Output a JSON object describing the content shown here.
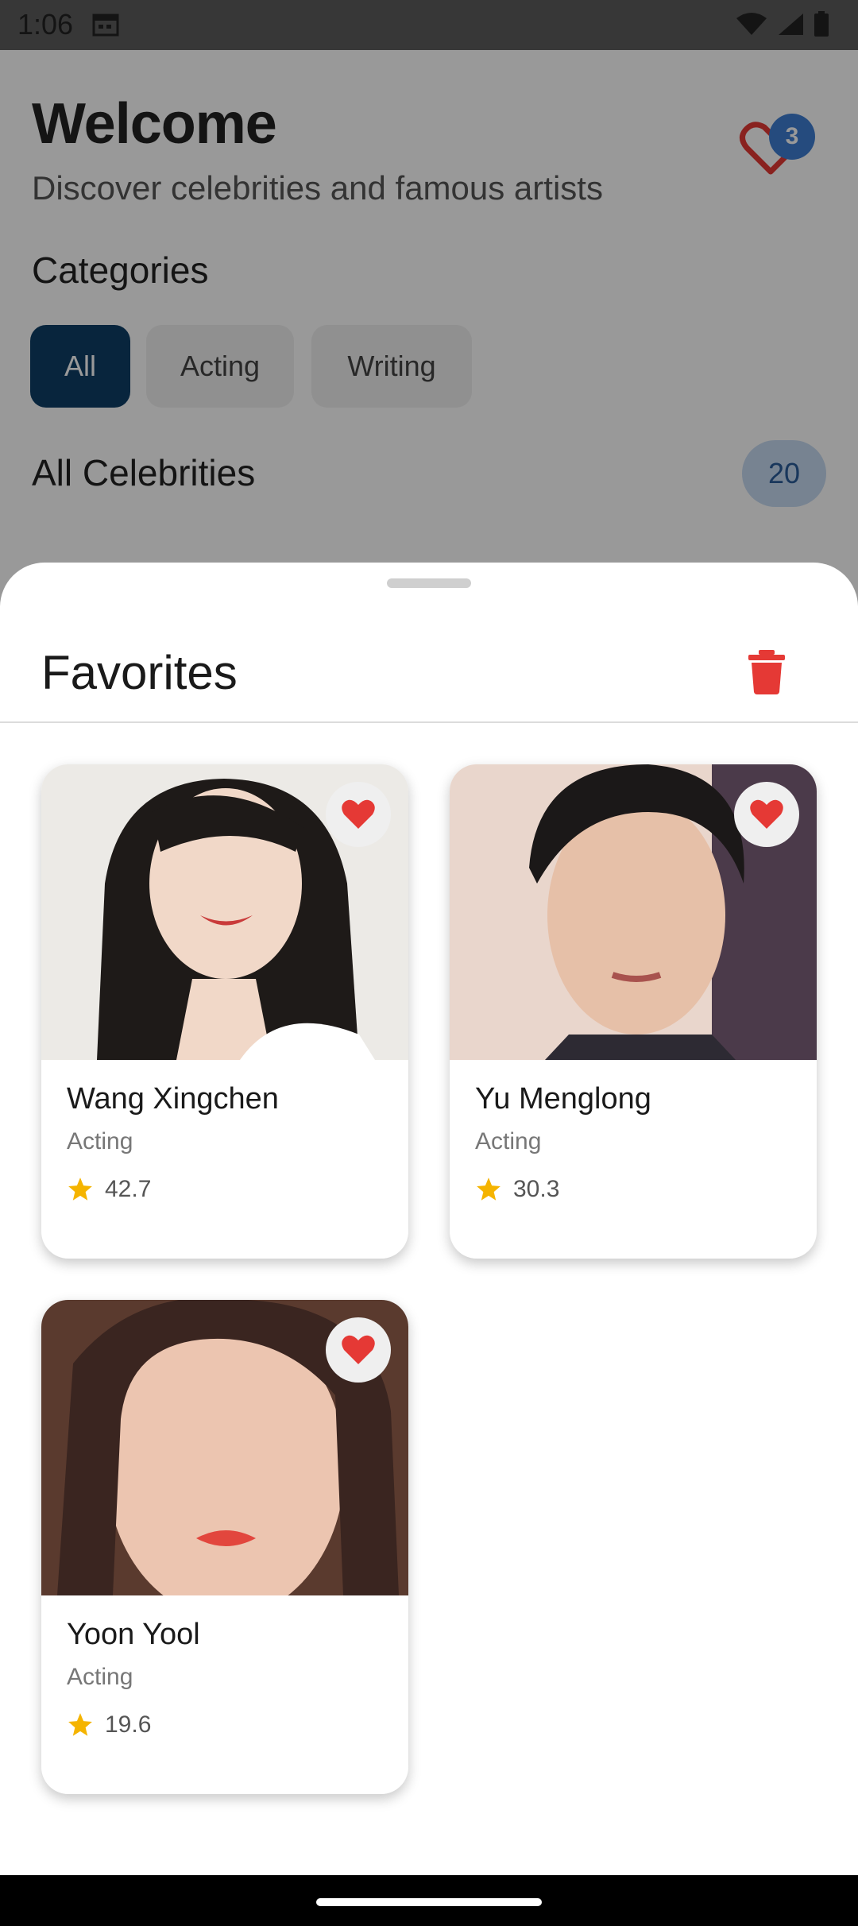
{
  "status_bar": {
    "time": "1:06",
    "icons": [
      "calendar-icon",
      "wifi-icon",
      "signal-icon",
      "battery-icon"
    ]
  },
  "header": {
    "title": "Welcome",
    "subtitle": "Discover celebrities and famous artists",
    "favorites_count": "3"
  },
  "categories": {
    "title": "Categories",
    "chips": [
      {
        "label": "All",
        "selected": true
      },
      {
        "label": "Acting",
        "selected": false
      },
      {
        "label": "Writing",
        "selected": false
      }
    ]
  },
  "all_celebrities": {
    "title": "All Celebrities",
    "count": "20"
  },
  "favorites_sheet": {
    "title": "Favorites",
    "items": [
      {
        "name": "Wang Xingchen",
        "category": "Acting",
        "rating": "42.7"
      },
      {
        "name": "Yu Menglong",
        "category": "Acting",
        "rating": "30.3"
      },
      {
        "name": "Yoon Yool",
        "category": "Acting",
        "rating": "19.6"
      }
    ]
  },
  "colors": {
    "accent": "#0e3e66",
    "badge": "#3f7ed3",
    "heart": "#e53935",
    "trash": "#e53935",
    "star": "#f5b400"
  }
}
